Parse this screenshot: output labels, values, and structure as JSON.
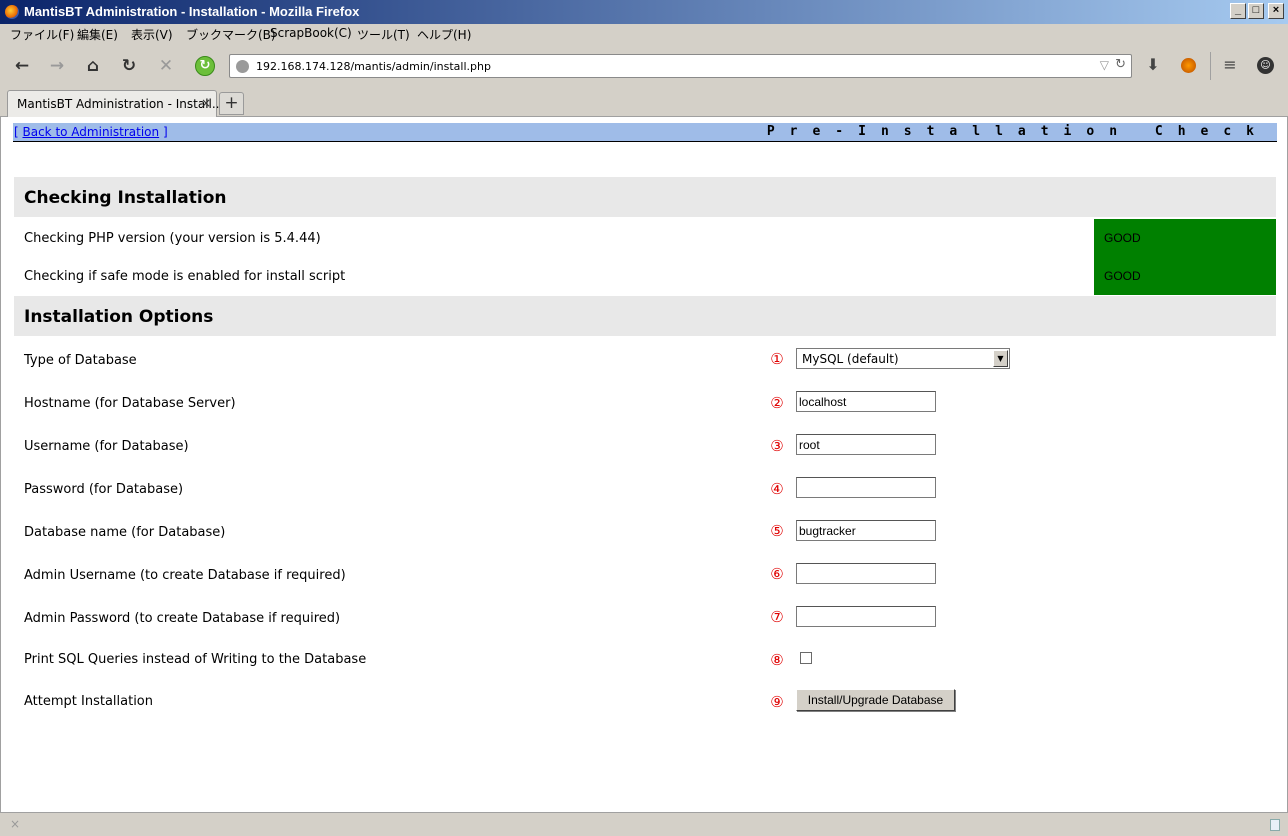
{
  "window": {
    "title": "MantisBT Administration - Installation - Mozilla Firefox",
    "buttons": {
      "minimize": "_",
      "maximize": "□",
      "close": "×"
    }
  },
  "menu": {
    "items": [
      "ファイル(F)",
      "編集(E)",
      "表示(V)",
      "ブックマーク(B)",
      "ScrapBook(C)",
      "ツール(T)",
      "ヘルプ(H)"
    ]
  },
  "toolbar": {
    "url": "192.168.174.128/mantis/admin/install.php",
    "icons": [
      "back-icon",
      "forward-icon",
      "home-icon",
      "reload-icon",
      "stop-icon",
      "sync-icon",
      "download-icon",
      "scrapbook-icon",
      "menu-icon",
      "account-icon"
    ]
  },
  "tabs": [
    {
      "label": "MantisBT Administration - Install...",
      "close": "×"
    }
  ],
  "newtab_label": "+",
  "page": {
    "back_prefix": "[ ",
    "back_link": "Back to Administration",
    "back_suffix": " ]",
    "heading": "Pre-Installation Check"
  },
  "checking": {
    "title": "Checking Installation",
    "rows": [
      {
        "label": "Checking PHP version (your version is 5.4.44)",
        "status": "GOOD"
      },
      {
        "label": "Checking if safe mode is enabled for install script",
        "status": "GOOD"
      }
    ],
    "status_color": "#008000"
  },
  "options": {
    "title": "Installation Options",
    "rows": [
      {
        "marker": "①",
        "label": "Type of Database",
        "value": "MySQL (default)"
      },
      {
        "marker": "②",
        "label": "Hostname (for Database Server)",
        "value": "localhost"
      },
      {
        "marker": "③",
        "label": "Username (for Database)",
        "value": "root"
      },
      {
        "marker": "④",
        "label": "Password (for Database)",
        "value": ""
      },
      {
        "marker": "⑤",
        "label": "Database name (for Database)",
        "value": "bugtracker"
      },
      {
        "marker": "⑥",
        "label": "Admin Username (to create Database if required)",
        "value": ""
      },
      {
        "marker": "⑦",
        "label": "Admin Password (to create Database if required)",
        "value": ""
      },
      {
        "marker": "⑧",
        "label": "Print SQL Queries instead of Writing to the Database",
        "checked": false
      },
      {
        "marker": "⑨",
        "label": "Attempt Installation",
        "button": "Install/Upgrade Database"
      }
    ],
    "marker_color": "#e00000"
  },
  "statusbar": {
    "close": "×"
  }
}
